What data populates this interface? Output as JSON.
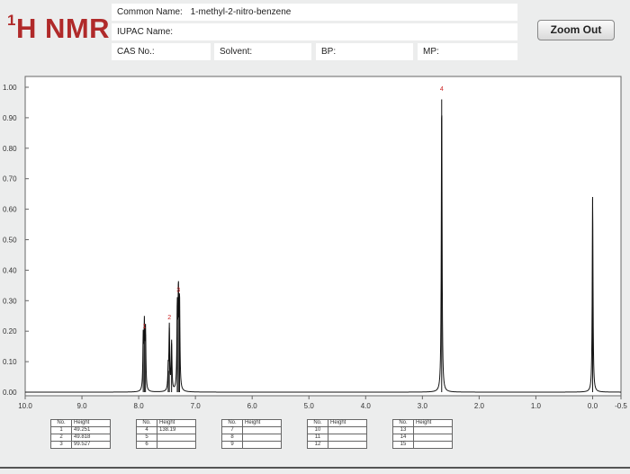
{
  "header": {
    "title_main": "H NMR",
    "title_sup": "1",
    "common_name_label": "Common Name:",
    "common_name_value": "1-methyl-2-nitro-benzene",
    "iupac_label": "IUPAC Name:",
    "iupac_value": "",
    "cas_label": "CAS No.:",
    "solvent_label": "Solvent:",
    "bp_label": "BP:",
    "mp_label": "MP:",
    "zoom_button": "Zoom Out"
  },
  "chart_data": {
    "type": "line",
    "title": "",
    "xlabel": "",
    "ylabel": "",
    "xlim": [
      10.0,
      -0.5
    ],
    "ylim": [
      0.0,
      1.0
    ],
    "x_reversed": true,
    "grid": false,
    "x_ticks": [
      "10.0",
      "9.0",
      "8.0",
      "7.0",
      "6.0",
      "5.0",
      "4.0",
      "3.0",
      "2.0",
      "1.0",
      "0.0",
      "-0.5"
    ],
    "x_tick_values": [
      10.0,
      9.0,
      8.0,
      7.0,
      6.0,
      5.0,
      4.0,
      3.0,
      2.0,
      1.0,
      0.0,
      -0.5
    ],
    "y_ticks": [
      "0.00",
      "0.10",
      "0.20",
      "0.30",
      "0.40",
      "0.50",
      "0.60",
      "0.70",
      "0.80",
      "0.90",
      "1.00"
    ],
    "y_tick_values": [
      0.0,
      0.1,
      0.2,
      0.3,
      0.4,
      0.5,
      0.6,
      0.7,
      0.8,
      0.9,
      1.0
    ],
    "series": [
      {
        "color": "#111111",
        "peaks": [
          {
            "x": 7.92,
            "y": 0.17
          },
          {
            "x": 7.9,
            "y": 0.2
          },
          {
            "x": 7.88,
            "y": 0.19
          },
          {
            "x": 7.48,
            "y": 0.07
          },
          {
            "x": 7.46,
            "y": 0.21
          },
          {
            "x": 7.42,
            "y": 0.16
          },
          {
            "x": 7.32,
            "y": 0.26
          },
          {
            "x": 7.3,
            "y": 0.3
          },
          {
            "x": 7.28,
            "y": 0.28
          },
          {
            "x": 2.66,
            "y": 0.96
          },
          {
            "x": 0.0,
            "y": 0.64
          }
        ]
      }
    ],
    "annotations": [
      {
        "label": "1",
        "x": 7.9,
        "y": 0.2
      },
      {
        "label": "2",
        "x": 7.46,
        "y": 0.23
      },
      {
        "label": "3",
        "x": 7.3,
        "y": 0.32
      },
      {
        "label": "4",
        "x": 2.66,
        "y": 0.98
      }
    ],
    "annotation_color": "#cc2222"
  },
  "peak_table": {
    "col_no": "No.",
    "col_height": "Height",
    "groups": [
      {
        "rows": [
          {
            "no": "1",
            "height": "49.251"
          },
          {
            "no": "2",
            "height": "49.818"
          },
          {
            "no": "3",
            "height": "99.527"
          }
        ]
      },
      {
        "rows": [
          {
            "no": "4",
            "height": "138.19"
          },
          {
            "no": "5",
            "height": ""
          },
          {
            "no": "6",
            "height": ""
          }
        ]
      },
      {
        "rows": [
          {
            "no": "7",
            "height": ""
          },
          {
            "no": "8",
            "height": ""
          },
          {
            "no": "9",
            "height": ""
          }
        ]
      },
      {
        "rows": [
          {
            "no": "10",
            "height": ""
          },
          {
            "no": "11",
            "height": ""
          },
          {
            "no": "12",
            "height": ""
          }
        ]
      },
      {
        "rows": [
          {
            "no": "13",
            "height": ""
          },
          {
            "no": "14",
            "height": ""
          },
          {
            "no": "15",
            "height": ""
          }
        ]
      }
    ]
  }
}
